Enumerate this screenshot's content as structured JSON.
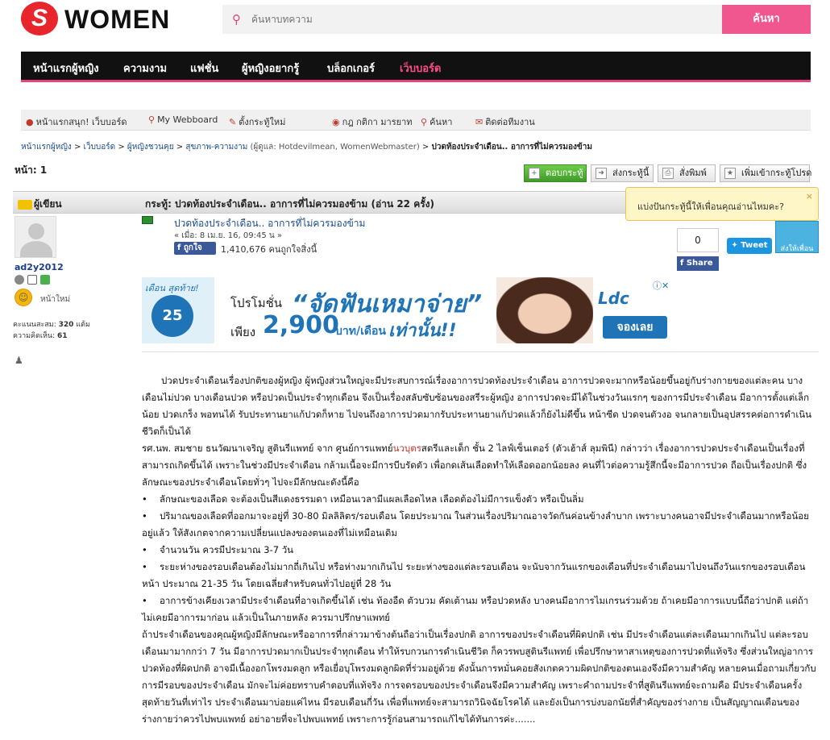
{
  "logo": {
    "letter": "S",
    "text": "WOMEN"
  },
  "search": {
    "placeholder": "ค้นหาบทความ",
    "button_label": "ค้นหา"
  },
  "nav": {
    "items": [
      {
        "label": "หน้าแรกผู้หญิง"
      },
      {
        "label": "ความงาม"
      },
      {
        "label": "แฟชั่น"
      },
      {
        "label": "ผู้หญิงอยากรู้"
      },
      {
        "label": "บล็อกเกอร์"
      },
      {
        "label": "เว็บบอร์ด"
      }
    ],
    "active_color": "#ff4b8b"
  },
  "toolbar": {
    "items": [
      {
        "label": "หน้าแรกสนุก! เว็บบอร์ด"
      },
      {
        "label": "My Webboard"
      },
      {
        "label": "ตั้งกระทู้ใหม่"
      },
      {
        "label": "กฎ กติกา มารยาท"
      },
      {
        "label": "ค้นหา"
      },
      {
        "label": "ติดต่อทีมงาน"
      }
    ]
  },
  "breadcrumb": {
    "items": [
      "หน้าแรกผู้หญิง",
      "เว็บบอร์ด",
      "ผู้หญิงชวนคุย",
      "สุขภาพ-ความงาม"
    ],
    "moderators": "(ผู้ดูแล: Hotdevilmean, WomenWebmaster)",
    "current": "ปวดท้องประจำเดือน.. อาการที่ไม่ควรมองข้าม",
    "separator": ">"
  },
  "page": {
    "label": "หน้า: 1"
  },
  "actions": {
    "reply": "ตอบกระทู้",
    "send_topic": "ส่งกระทู้นี้",
    "print": "สั่งพิมพ์",
    "favorite": "เพิ่มเข้ากระทู้โปรด"
  },
  "topic": {
    "author_header": "ผู้เขียน",
    "title_header": "กระทู้: ปวดท้องประจำเดือน.. อาการที่ไม่ควรมองข้าม  (อ่าน 22 ครั้ง)"
  },
  "tooltip": {
    "text": "แบ่งปันกระทู้นี้ให้เพื่อนคุณอ่านไหมคะ?",
    "close": "×"
  },
  "user": {
    "name": "ad2y2012",
    "rank": "หน้าใหม่",
    "stats_points_label": "คะแนนสะสม:",
    "stats_points": "320",
    "stats_points_unit": "แต้ม",
    "stats_comments_label": "ความคิดเห็น:",
    "stats_comments": "61"
  },
  "post": {
    "title": "ปวดท้องประจำเดือน.. อาการที่ไม่ควรมองข้าม",
    "date": "« เมื่อ: 8 เม.ย. 16, 09:45 น »",
    "like_label": "ถูกใจ",
    "like_count": "1,410,676 คนถูกใจสิ่งนี้"
  },
  "share": {
    "count": "0",
    "fb_label": "Share",
    "tweet_label": "Tweet",
    "send_friend_label": "ส่งให้เพื่อน"
  },
  "ad": {
    "corner": "เดือน สุดท้าย!",
    "circle": "25",
    "promo_label": "โปรโมชั่น",
    "headline": "“จัดฟันเหมาจ่าย”",
    "price_label": "เพียง",
    "price": "2,900",
    "unit": "บาท/เดือน",
    "only": "เท่านั้น!!",
    "brand": "Ldc",
    "cta": "จองเลย"
  },
  "article": {
    "p1": "ปวดประจำเดือนเรื่องปกติของผู้หญิง ผู้หญิงส่วนใหญ่จะมีประสบการณ์เรื่องอาการปวดท้องประจำเดือน อาการปวดจะมากหรือน้อยขึ้นอยู่กับร่างกายของแต่ละคน บางเดือนไม่ปวด บางเดือนปวด หรือปวดเป็นประจำทุกเดือน จึงเป็นเรื่องสลับซับซ้อนของสรีระผู้หญิง อาการปวดจะมีได้ในช่วงวันแรกๆ ของการมีประจำเดือน มีอาการตั้งแต่เล็กน้อย ปวดเกร็ง พอทนได้ รับประทานยาแก้ปวดก็หาย ไปจนถึงอาการปวดมากรับประทานยาแก้ปวดแล้วก็ยังไม่ดีขึ้น หน้าซีด ปวดจนตัวงอ จนกลายเป็นอุปสรรคต่อการดำเนินชีวิตก็เป็นได้",
    "p2a": "รศ.นพ. สมชาย  ธนวัฒนาเจริญ สูตินรีแพทย์ จาก ศูนย์การแพทย์",
    "p2_link": "นวบุตร",
    "p2b": "สตรีและเด็ก ชั้น 2 ไลฟ์เซ็นเตอร์ (ตัวเฮ้าส์ ลุมพินี) กล่าวว่า เรื่องอาการปวดประจำเดือนเป็นเรื่องที่สามารถเกิดขึ้นได้ เพราะในช่วงมีประจำเดือน กล้ามเนื้อจะมีการบีบรัดตัว เพื่อกดเส้นเลือดทำให้เลือดออกน้อยลง คนที่ไวต่อความรู้สึกนี้จะมีอาการปวด ถือเป็นเรื่องปกติ ซึ่งลักษณะของประจำเดือนโดยทั่วๆ ไปจะมีลักษณะดังนี้คือ",
    "b1": "ลักษณะของเลือด  จะต้องเป็นสีแดงธรรมดา เหมือนเวลามีแผลเลือดไหล เลือดต้องไม่มีการแข็งตัว หรือเป็นลิ่ม",
    "b2": "ปริมาณของเลือดที่ออกมาจะอยู่ที่  30-80 มิลลิลิตร/รอบเดือน โดยประมาณ ในส่วนเรื่องปริมาณอาจวัดกันค่อนข้างลำบาก เพราะบางคนอาจมีประจำเดือนมากหรือน้อยอยู่แล้ว ให้สังเกตจากความเปลี่ยนแปลงของตนเองที่ไม่เหมือนเดิม",
    "b3": "จำนวนวัน  ควรมีประมาณ 3-7 วัน",
    "b4": "ระยะห่างของรอบเดือนต้องไม่มากถี่เกินไป หรือห่างมากเกินไป ระยะห่างของแต่ละรอบเดือน จะนับจากวันแรกของเดือนที่ประจำเดือนมาไปจนถึงวันแรกของรอบเดือนหน้า ประมาณ 21-35 วัน โดยเฉลี่ยสำหรับคนทั่วไปอยู่ที่ 28 วัน",
    "b5": "อาการข้างเคียงเวลามีประจำเดือนที่อาจเกิดขึ้นได้ เช่น ท้องอืด ตัวบวม คัดเต้านม หรือปวดหลัง บางคนมีอาการไมเกรนร่วมด้วย ถ้าเคยมีอาการแบบนี้ถือว่าปกติ แต่ถ้าไม่เคยมีอาการมาก่อน แล้วเป็นในภายหลัง ควรมาปรึกษาแพทย์",
    "p3": "ถ้าประจำเดือนของคุณผู้หญิงมีลักษณะหรืออาการที่กล่าวมาข้างต้นถือว่าเป็นเรื่องปกติ อาการของประจำเดือนที่ผิดปกติ เช่น มีประจำเดือนแต่ละเดือนมากเกินไป แต่ละรอบเดือนมามากกว่า 7 วัน มีอาการปวดมากเป็นประจำทุกเดือน ทำให้รบกวนการดำเนินชีวิต ก็ควรพบสูตินรีแพทย์ เพื่อปรึกษาหาสาเหตุของการปวดที่แท้จริง ซึ่งส่วนใหญ่อาการปวดท้องที่ผิดปกติ อาจมีเนื้องอกโพรงมดลูก หรือเยื่อบุโพรงมดลูกผิดที่ร่วมอยู่ด้วย ดังนั้นการหมั่นคอยสังเกตความผิดปกติของตนเองจึงมีความสำคัญ หลายคนเมื่อถามเกี่ยวกับการมีรอบของประจำเดือน มักจะไม่ค่อยทราบคำตอบที่แท้จริง การจดรอบของประจำเดือนจึงมีความสำคัญ เพราะคำถามประจำที่สูตินรีแพทย์จะถามคือ มีประจำเดือนครั้งสุดท้ายวันที่เท่าไร ประจำเดือนมาบ่อยแค่ไหน มีรอบเดือนกี่วัน เพื่อที่แพทย์จะสามารถวินิจฉัยโรคได้ และยังเป็นการบ่งบอกนัยที่สำคัญของร่างกาย เป็นสัญญาณเตือนของร่างกายว่าควรไปพบแพทย์ อย่าอายที่จะไปพบแพทย์ เพราะการรู้ก่อนสามารถแก้ไขได้ทันการค่ะ......."
  }
}
